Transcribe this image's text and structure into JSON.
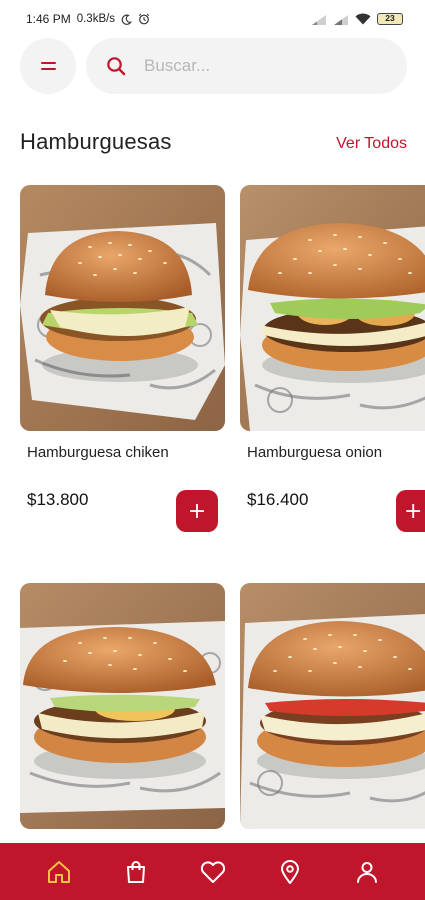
{
  "status_bar": {
    "time": "1:46 PM",
    "network_speed": "0.3kB/s",
    "battery_level": "23"
  },
  "search": {
    "placeholder": "Buscar..."
  },
  "section": {
    "title": "Hamburguesas",
    "see_all_label": "Ver Todos"
  },
  "products": [
    {
      "name": "Hamburguesa chiken",
      "price": "$13.800",
      "add_label": "+"
    },
    {
      "name": "Hamburguesa onion",
      "price": "$16.400",
      "add_label": "+"
    },
    {
      "name": "",
      "price": "",
      "add_label": ""
    },
    {
      "name": "",
      "price": "",
      "add_label": ""
    }
  ],
  "bottom_nav": {
    "items": [
      {
        "icon": "home-icon",
        "active": true
      },
      {
        "icon": "shopping-bag-icon",
        "active": false
      },
      {
        "icon": "heart-icon",
        "active": false
      },
      {
        "icon": "location-pin-icon",
        "active": false
      },
      {
        "icon": "user-icon",
        "active": false
      }
    ]
  },
  "colors": {
    "accent": "#c0162c",
    "active_nav_icon": "#f5c242",
    "nav_icon": "#ffffff",
    "search_bg": "#f3f3f3"
  }
}
